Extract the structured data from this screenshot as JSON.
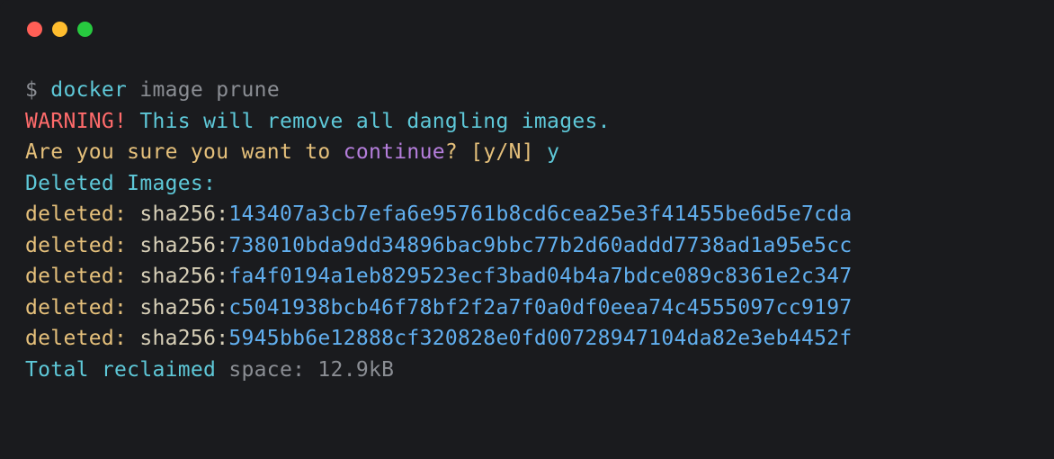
{
  "prompt": "$ ",
  "command": {
    "cmd": "docker",
    "args": "image prune"
  },
  "warning": {
    "label": "WARNING!",
    "text": " This will remove all dangling images."
  },
  "confirm": {
    "prefix": "Are you sure you want to ",
    "keyword": "continue",
    "suffix": "? [y/N] ",
    "answer": "y"
  },
  "deleted_header": "Deleted Images:",
  "deleted": [
    {
      "label": "deleted: ",
      "prefix": "sha256:",
      "hash": "143407a3cb7efa6e95761b8cd6cea25e3f41455be6d5e7cda"
    },
    {
      "label": "deleted: ",
      "prefix": "sha256:",
      "hash": "738010bda9dd34896bac9bbc77b2d60addd7738ad1a95e5cc"
    },
    {
      "label": "deleted: ",
      "prefix": "sha256:",
      "hash": "fa4f0194a1eb829523ecf3bad04b4a7bdce089c8361e2c347"
    },
    {
      "label": "deleted: ",
      "prefix": "sha256:",
      "hash": "c5041938bcb46f78bf2f2a7f0a0df0eea74c4555097cc9197"
    },
    {
      "label": "deleted: ",
      "prefix": "sha256:",
      "hash": "5945bb6e12888cf320828e0fd00728947104da82e3eb4452f"
    }
  ],
  "total": {
    "label": "Total reclaimed",
    "suffix": " space: ",
    "value": "12.9kB"
  }
}
